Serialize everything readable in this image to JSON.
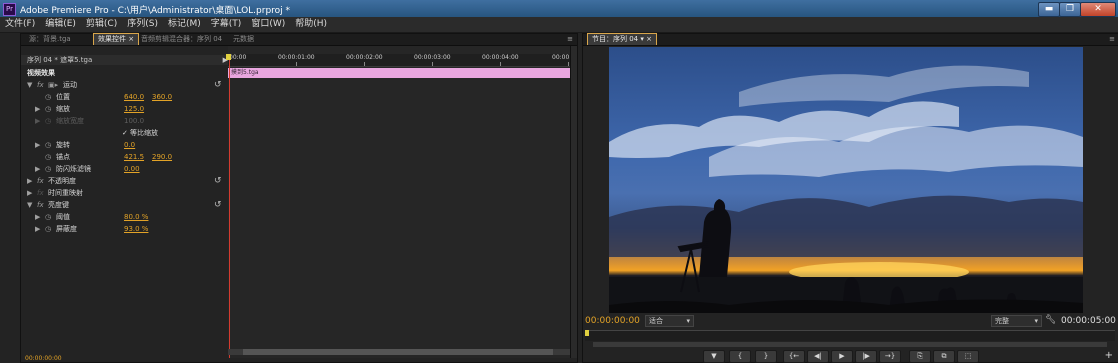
{
  "window": {
    "app_icon": "Pr",
    "title": "Adobe Premiere Pro - C:\\用户\\Administrator\\桌面\\LOL.prproj *",
    "min_icon": "▬",
    "max_icon": "❐",
    "close_icon": "✕"
  },
  "menu": [
    "文件(F)",
    "编辑(E)",
    "剪辑(C)",
    "序列(S)",
    "标记(M)",
    "字幕(T)",
    "窗口(W)",
    "帮助(H)"
  ],
  "left_tabs": [
    "源：背景.tga",
    "效果控件 ×",
    "音频剪辑混合器：序列 04",
    "元数据"
  ],
  "effect_controls": {
    "sequence": "序列 04 * 遮罩5.tga",
    "video_effects": "视频效果",
    "motion": "运动",
    "position_label": "位置",
    "position_x": "640.0",
    "position_y": "360.0",
    "scale_label": "缩放",
    "scale_value": "125.0",
    "scale_width_label": "缩放宽度",
    "scale_width_value": "100.0",
    "uniform_scale": "等比缩放",
    "rotation_label": "旋转",
    "rotation_value": "0.0",
    "anchor_label": "锚点",
    "anchor_x": "421.5",
    "anchor_y": "290.0",
    "flicker_label": "防闪烁滤镜",
    "flicker_value": "0.00",
    "opacity": "不透明度",
    "time_remap": "时间重映射",
    "luma_key": "亮度键",
    "threshold_label": "阈值",
    "threshold_value": "80.0 %",
    "cutoff_label": "屏蔽度",
    "cutoff_value": "93.0 %",
    "bottom_timecode": "00:00:00:00"
  },
  "ec_timeline": {
    "ruler": [
      "00:00",
      "00:00:01:00",
      "00:00:02:00",
      "00:00:03:00",
      "00:00:04:00",
      "00:00"
    ],
    "clip_name": "摸到5.tga"
  },
  "right_tabs": [
    "节目：序列 04 ▾ ×"
  ],
  "program": {
    "timecode_current": "00:00:00:00",
    "fit": "适合",
    "quality": "完整",
    "timecode_duration": "00:00:05:00",
    "controls": [
      "▼",
      "{",
      "}",
      "{←",
      "◀|",
      "▶",
      "|▶",
      "→}",
      "⎘",
      "⧉",
      "⬚"
    ],
    "add_button": "+"
  },
  "colors": {
    "accent": "#e3a327",
    "clip": "#e9a6df",
    "playhead": "#d43b2f"
  }
}
